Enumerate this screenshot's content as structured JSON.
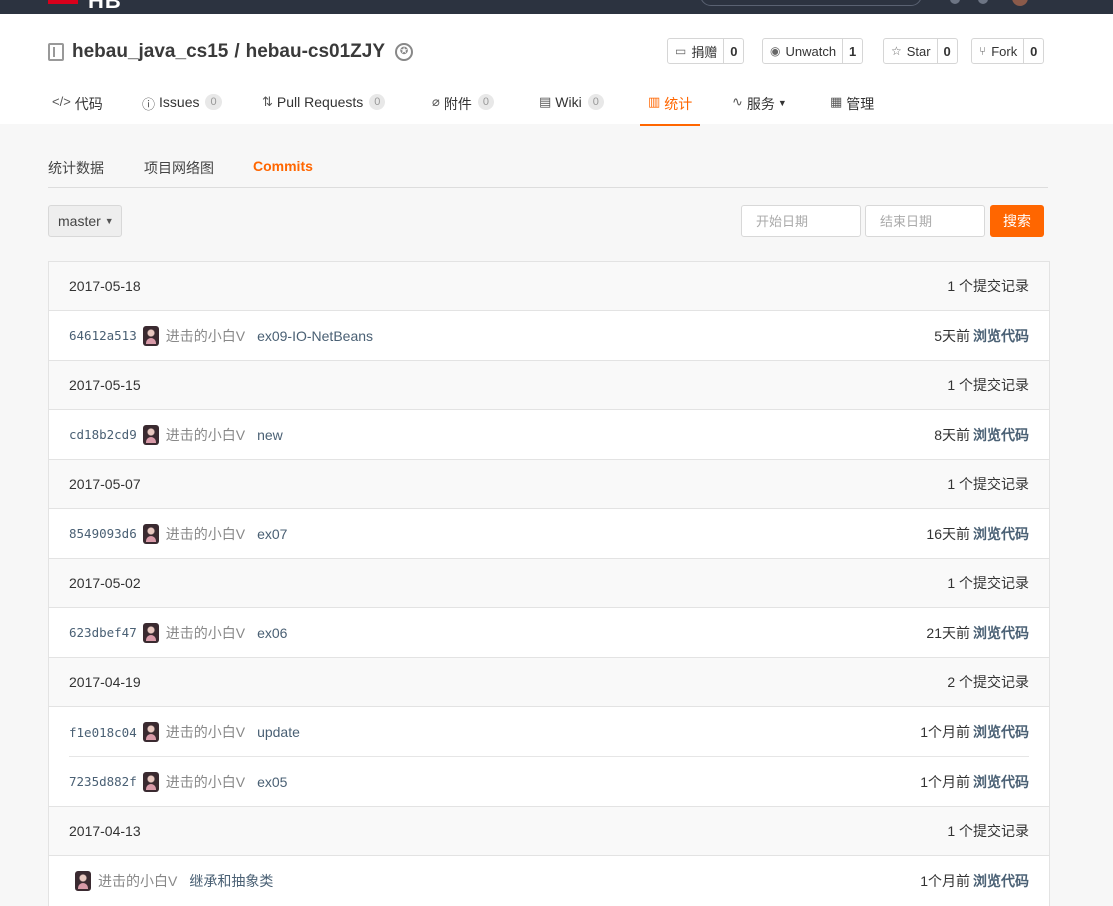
{
  "topbar": {
    "logo_text": "HB"
  },
  "repo": {
    "owner": "hebau_java_cs15",
    "separator": "/",
    "name": "hebau-cs01ZJY"
  },
  "actions": [
    {
      "icon": "donate-icon",
      "label": "捐赠",
      "count": "0"
    },
    {
      "icon": "eye-icon",
      "label": "Unwatch",
      "count": "1"
    },
    {
      "icon": "star-icon",
      "label": "Star",
      "count": "0"
    },
    {
      "icon": "fork-icon",
      "label": "Fork",
      "count": "0"
    }
  ],
  "tabs": [
    {
      "icon": "code-icon",
      "label": "代码",
      "count": null
    },
    {
      "icon": "issues-icon",
      "label": "Issues",
      "count": "0"
    },
    {
      "icon": "pull-request-icon",
      "label": "Pull Requests",
      "count": "0"
    },
    {
      "icon": "attachment-icon",
      "label": "附件",
      "count": "0"
    },
    {
      "icon": "wiki-icon",
      "label": "Wiki",
      "count": "0"
    },
    {
      "icon": "stats-icon",
      "label": "统计",
      "count": null,
      "active": true
    },
    {
      "icon": "service-icon",
      "label": "服务",
      "count": null
    },
    {
      "icon": "manage-icon",
      "label": "管理",
      "count": null
    }
  ],
  "subnav": {
    "stats": "统计数据",
    "network": "项目网络图",
    "commits": "Commits"
  },
  "filters": {
    "branch": "master",
    "start_placeholder": "开始日期",
    "end_placeholder": "结束日期",
    "search_label": "搜索"
  },
  "groups": [
    {
      "date": "2017-05-18",
      "summary": "1 个提交记录",
      "commits": [
        {
          "sha": "64612a513",
          "author": "进击的小白V",
          "message": "ex09-IO-NetBeans",
          "time": "5天前",
          "browse": "浏览代码"
        }
      ]
    },
    {
      "date": "2017-05-15",
      "summary": "1 个提交记录",
      "commits": [
        {
          "sha": "cd18b2cd9",
          "author": "进击的小白V",
          "message": "new",
          "time": "8天前",
          "browse": "浏览代码"
        }
      ]
    },
    {
      "date": "2017-05-07",
      "summary": "1 个提交记录",
      "commits": [
        {
          "sha": "8549093d6",
          "author": "进击的小白V",
          "message": "ex07",
          "time": "16天前",
          "browse": "浏览代码"
        }
      ]
    },
    {
      "date": "2017-05-02",
      "summary": "1 个提交记录",
      "commits": [
        {
          "sha": "623dbef47",
          "author": "进击的小白V",
          "message": "ex06",
          "time": "21天前",
          "browse": "浏览代码"
        }
      ]
    },
    {
      "date": "2017-04-19",
      "summary": "2 个提交记录",
      "commits": [
        {
          "sha": "f1e018c04",
          "author": "进击的小白V",
          "message": "update",
          "time": "1个月前",
          "browse": "浏览代码"
        },
        {
          "sha": "7235d882f",
          "author": "进击的小白V",
          "message": "ex05",
          "time": "1个月前",
          "browse": "浏览代码"
        }
      ]
    },
    {
      "date": "2017-04-13",
      "summary": "1 个提交记录",
      "commits": [
        {
          "sha": "",
          "author": "进击的小白V",
          "message": "继承和抽象类",
          "time": "1个月前",
          "browse": "浏览代码"
        }
      ]
    }
  ]
}
